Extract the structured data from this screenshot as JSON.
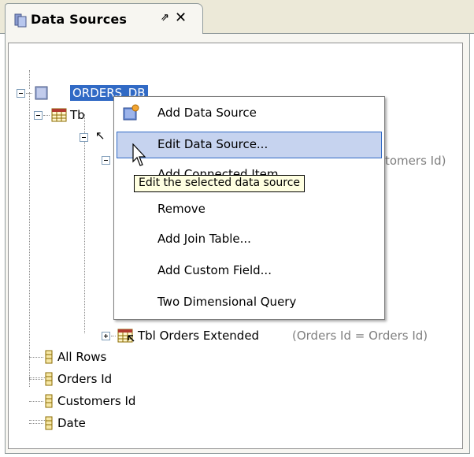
{
  "window": {
    "tab_title": "Data Sources",
    "tab_pin_glyph": "⇗",
    "tab_close_glyph": "✕"
  },
  "toolbar": [
    {
      "icon": "add-data-source-icon",
      "active": true
    },
    {
      "icon": "remove-data-source-icon",
      "active": false
    }
  ],
  "tree": {
    "root": {
      "label": "ORDERS_DB",
      "icon": "database-icon",
      "expanded": true,
      "selected": true
    },
    "table_node": {
      "label": "Tb",
      "icon": "table-icon",
      "expanded": true
    },
    "sub_node": {
      "label": "↖",
      "expanded": true
    },
    "partial_hidden_text": "tomers Id)",
    "join_table": {
      "label": "Tbl Orders Extended",
      "detail": "(Orders Id = Orders Id)",
      "icon": "join-table-icon",
      "expanded": false
    },
    "fields": [
      {
        "label": "All Rows",
        "icon": "field-icon"
      },
      {
        "label": "Orders Id",
        "icon": "field-icon"
      },
      {
        "label": "Customers Id",
        "icon": "field-icon"
      },
      {
        "label": "Date",
        "icon": "field-icon"
      }
    ]
  },
  "context_menu": {
    "items": [
      {
        "label": "Add Data Source",
        "icon": "add-data-source-icon",
        "highlighted": false
      },
      {
        "label": "Edit Data Source...",
        "highlighted": true
      },
      {
        "label": "Add Connected Item",
        "highlighted": false
      },
      {
        "label": "Remove",
        "highlighted": false
      },
      {
        "label": "Add Join Table...",
        "highlighted": false
      },
      {
        "label": "Add Custom Field...",
        "highlighted": false
      },
      {
        "label": "Two Dimensional Query",
        "highlighted": false
      }
    ]
  },
  "tooltip": {
    "text": "Edit the selected data source"
  },
  "colors": {
    "selection": "#316ac5",
    "menu_highlight": "#c6d3ef",
    "tooltip_bg": "#ffffe1",
    "panel_bg": "#f7f6f1",
    "muted_text": "#7f7f7f"
  }
}
